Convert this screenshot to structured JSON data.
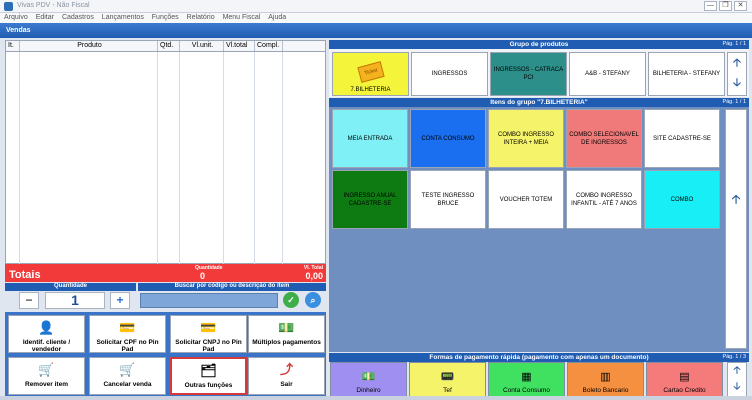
{
  "window": {
    "title": "Vivas PDV - Não Fiscal",
    "btn_min": "—",
    "btn_max": "❐",
    "btn_close": "✕"
  },
  "menu": [
    "Arquivo",
    "Editar",
    "Cadastros",
    "Lançamentos",
    "Funções",
    "Relatório",
    "Menu Fiscal",
    "Ajuda"
  ],
  "header": {
    "title": "Vendas"
  },
  "grid": {
    "columns": [
      "It.",
      "Produto",
      "Qtd.",
      "Vl.unit.",
      "Vl.total",
      "Compl."
    ]
  },
  "totals": {
    "label": "Totais",
    "qty_label": "Quantidade",
    "qty_value": "0",
    "total_label": "Vl. Total",
    "total_value": "0,00"
  },
  "entry": {
    "qty_head": "Quantidade",
    "search_head": "Buscar por código ou descrição do item",
    "qty_value": "1",
    "minus": "−",
    "plus": "+"
  },
  "actions": [
    {
      "label": "Identif. cliente / vendedor",
      "icon": "👤"
    },
    {
      "label": "Solicitar CPF no Pin Pad",
      "icon": "💳"
    },
    {
      "label": "Solicitar CNPJ no Pin Pad",
      "icon": "💳"
    },
    {
      "label": "Múltiplos pagamentos",
      "icon": "💵"
    },
    {
      "label": "Remover item",
      "icon": "🛒"
    },
    {
      "label": "Cancelar venda",
      "icon": "🛒"
    },
    {
      "label": "Outras funções",
      "icon": "🗂"
    },
    {
      "label": "Sair",
      "icon": "⤴"
    }
  ],
  "groups": {
    "title": "Grupo de produtos",
    "page": "Pág. 1 / 1",
    "items": [
      {
        "label": "7.BILHETERIA",
        "color": "#f4f43a"
      },
      {
        "label": "INGRESSOS",
        "color": "#ffffff"
      },
      {
        "label": "INGRESSOS - CATRACA PCI",
        "color": "#2d8f8a"
      },
      {
        "label": "A&B - STEFANY",
        "color": "#ffffff"
      },
      {
        "label": "BILHETERIA - STEFANY",
        "color": "#ffffff"
      }
    ],
    "ticket_text": "Ticket"
  },
  "items": {
    "title": "Itens do grupo \"7.BILHETERIA\"",
    "page": "Pág. 1 / 1",
    "tiles": [
      {
        "label": "MEIA ENTRADA",
        "color": "#7ff0f5"
      },
      {
        "label": "CONTA CONSUMO",
        "color": "#1a6ff0"
      },
      {
        "label": "COMBO INGRESSO INTEIRA + MEIA",
        "color": "#f5f36a"
      },
      {
        "label": "COMBO SELECIONAVEL DE INGRESSOS",
        "color": "#f07a7a"
      },
      {
        "label": "SITE CADASTRE-SE",
        "color": "#ffffff"
      },
      {
        "label": "INGRESSO ANUAL CADASTRE-SE",
        "color": "#0e7a12"
      },
      {
        "label": "TESTE INGRESSO BRUCE",
        "color": "#ffffff"
      },
      {
        "label": "VOUCHER TOTEM",
        "color": "#ffffff"
      },
      {
        "label": "COMBO INGRESSO INFANTIL - ATÉ 7 ANOS",
        "color": "#ffffff"
      },
      {
        "label": "COMBO",
        "color": "#17eef5"
      }
    ]
  },
  "payments": {
    "title": "Formas de pagamento rápida (pagamento com apenas um documento)",
    "page": "Pág. 1 / 3",
    "items": [
      {
        "label": "Dinheiro",
        "color": "#9f8ff0",
        "icon": "💵"
      },
      {
        "label": "Tef",
        "color": "#f5f36a",
        "icon": "📟"
      },
      {
        "label": "Conta Consumo",
        "color": "#40e060",
        "icon": "▦"
      },
      {
        "label": "Boleto Bancario",
        "color": "#f59040",
        "icon": "▥"
      },
      {
        "label": "Cartao Credito",
        "color": "#f57a7a",
        "icon": "▤"
      }
    ]
  },
  "arrows": {
    "up": "🡡",
    "down": "🡣"
  }
}
